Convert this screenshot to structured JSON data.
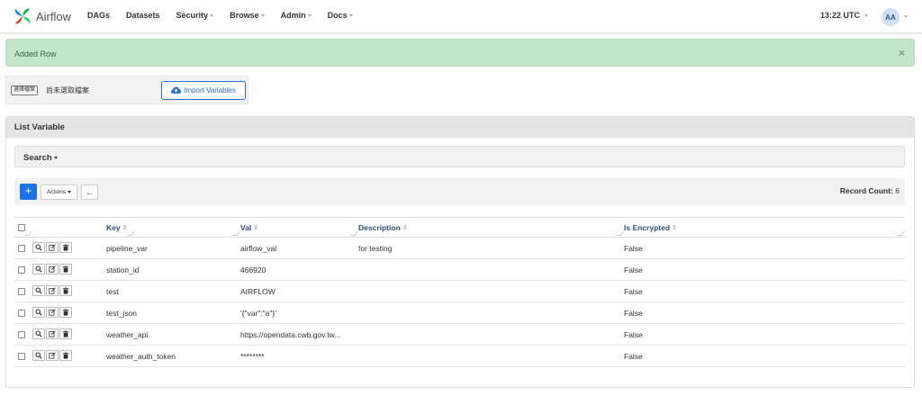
{
  "brand": {
    "name": "Airflow"
  },
  "nav": {
    "items": [
      {
        "label": "DAGs",
        "dropdown": false
      },
      {
        "label": "Datasets",
        "dropdown": false
      },
      {
        "label": "Security",
        "dropdown": true
      },
      {
        "label": "Browse",
        "dropdown": true
      },
      {
        "label": "Admin",
        "dropdown": true
      },
      {
        "label": "Docs",
        "dropdown": true
      }
    ],
    "time": "13:22 UTC",
    "avatar": "AA"
  },
  "alert": {
    "message": "Added Row",
    "close": "×"
  },
  "import": {
    "choose_file": "選擇檔案",
    "no_file": "尚未選取檔案",
    "button": "Import Variables"
  },
  "panel": {
    "title": "List Variable",
    "search_label": "Search",
    "add_label": "+",
    "actions_label": "Actions",
    "back_label": "←",
    "record_count_label": "Record Count:",
    "record_count": "6"
  },
  "table": {
    "headers": {
      "key": "Key",
      "val": "Val",
      "description": "Description",
      "is_encrypted": "Is Encrypted"
    },
    "sort_glyph": "⇕",
    "rows": [
      {
        "key": "pipeline_var",
        "val": "airflow_val",
        "description": "for testing",
        "is_encrypted": "False"
      },
      {
        "key": "station_id",
        "val": "466920",
        "description": "",
        "is_encrypted": "False"
      },
      {
        "key": "test",
        "val": "AIRFLOW",
        "description": "",
        "is_encrypted": "False"
      },
      {
        "key": "test_json",
        "val": "'{\"var\":\"a\"}'",
        "description": "",
        "is_encrypted": "False"
      },
      {
        "key": "weather_api",
        "val": "https://opendata.cwb.gov.tw...",
        "description": "",
        "is_encrypted": "False"
      },
      {
        "key": "weather_auth_token",
        "val": "********",
        "description": "",
        "is_encrypted": "False"
      }
    ]
  },
  "colors": {
    "primary": "#1a73e8",
    "alert_bg": "#c3e6cb",
    "header_text": "#2f4e7a"
  },
  "icons": {
    "row_actions": [
      "search-icon",
      "edit-icon",
      "trash-icon"
    ],
    "import": "cloud-upload-icon"
  }
}
